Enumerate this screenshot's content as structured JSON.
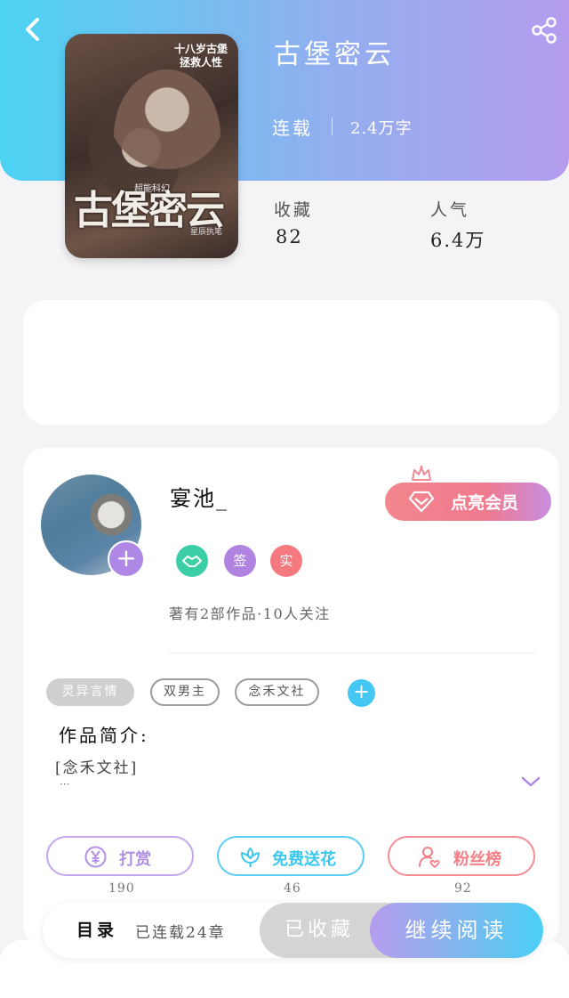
{
  "book": {
    "title": "古堡密云",
    "status": "连载",
    "word_count": "2.4万字",
    "stats": [
      {
        "label": "收藏",
        "value": "82"
      },
      {
        "label": "人气",
        "value": "6.4万"
      }
    ],
    "cover": {
      "top_text_line1": "十八岁古堡",
      "top_text_line2": "拯救人性",
      "big_text": "古堡密云",
      "small_text": "超能科幻",
      "small_text2": "星辰执笔"
    }
  },
  "author": {
    "name": "宴池_",
    "badges": [
      {
        "text": "",
        "icon": "handshake-icon",
        "color": "#3ccfa6"
      },
      {
        "text": "签",
        "color": "#b183e0"
      },
      {
        "text": "实",
        "color": "#f47a7f"
      }
    ],
    "meta": "著有2部作品·10人关注",
    "vip_label": "点亮会员"
  },
  "tags": [
    "灵异言情",
    "双男主",
    "念禾文社"
  ],
  "intro": {
    "title": "作品简介:",
    "text": "[念禾文社]",
    "ellipsis": "···"
  },
  "actions": [
    {
      "label": "打赏",
      "count": "190",
      "color": "#b28fe6",
      "icon": "yen-icon"
    },
    {
      "label": "免费送花",
      "count": "46",
      "color": "#3cc8ef",
      "icon": "flower-icon"
    },
    {
      "label": "粉丝榜",
      "count": "92",
      "color": "#f47f86",
      "icon": "fan-icon"
    }
  ],
  "bottom_bar": {
    "catalog": "目录",
    "chapters": "已连载24章",
    "collected": "已收藏",
    "read": "继续阅读"
  },
  "icons": {
    "back": "back-icon",
    "share": "share-icon",
    "crown": "crown-icon",
    "gem": "diamond-icon",
    "expand": "chevron-down-icon"
  }
}
